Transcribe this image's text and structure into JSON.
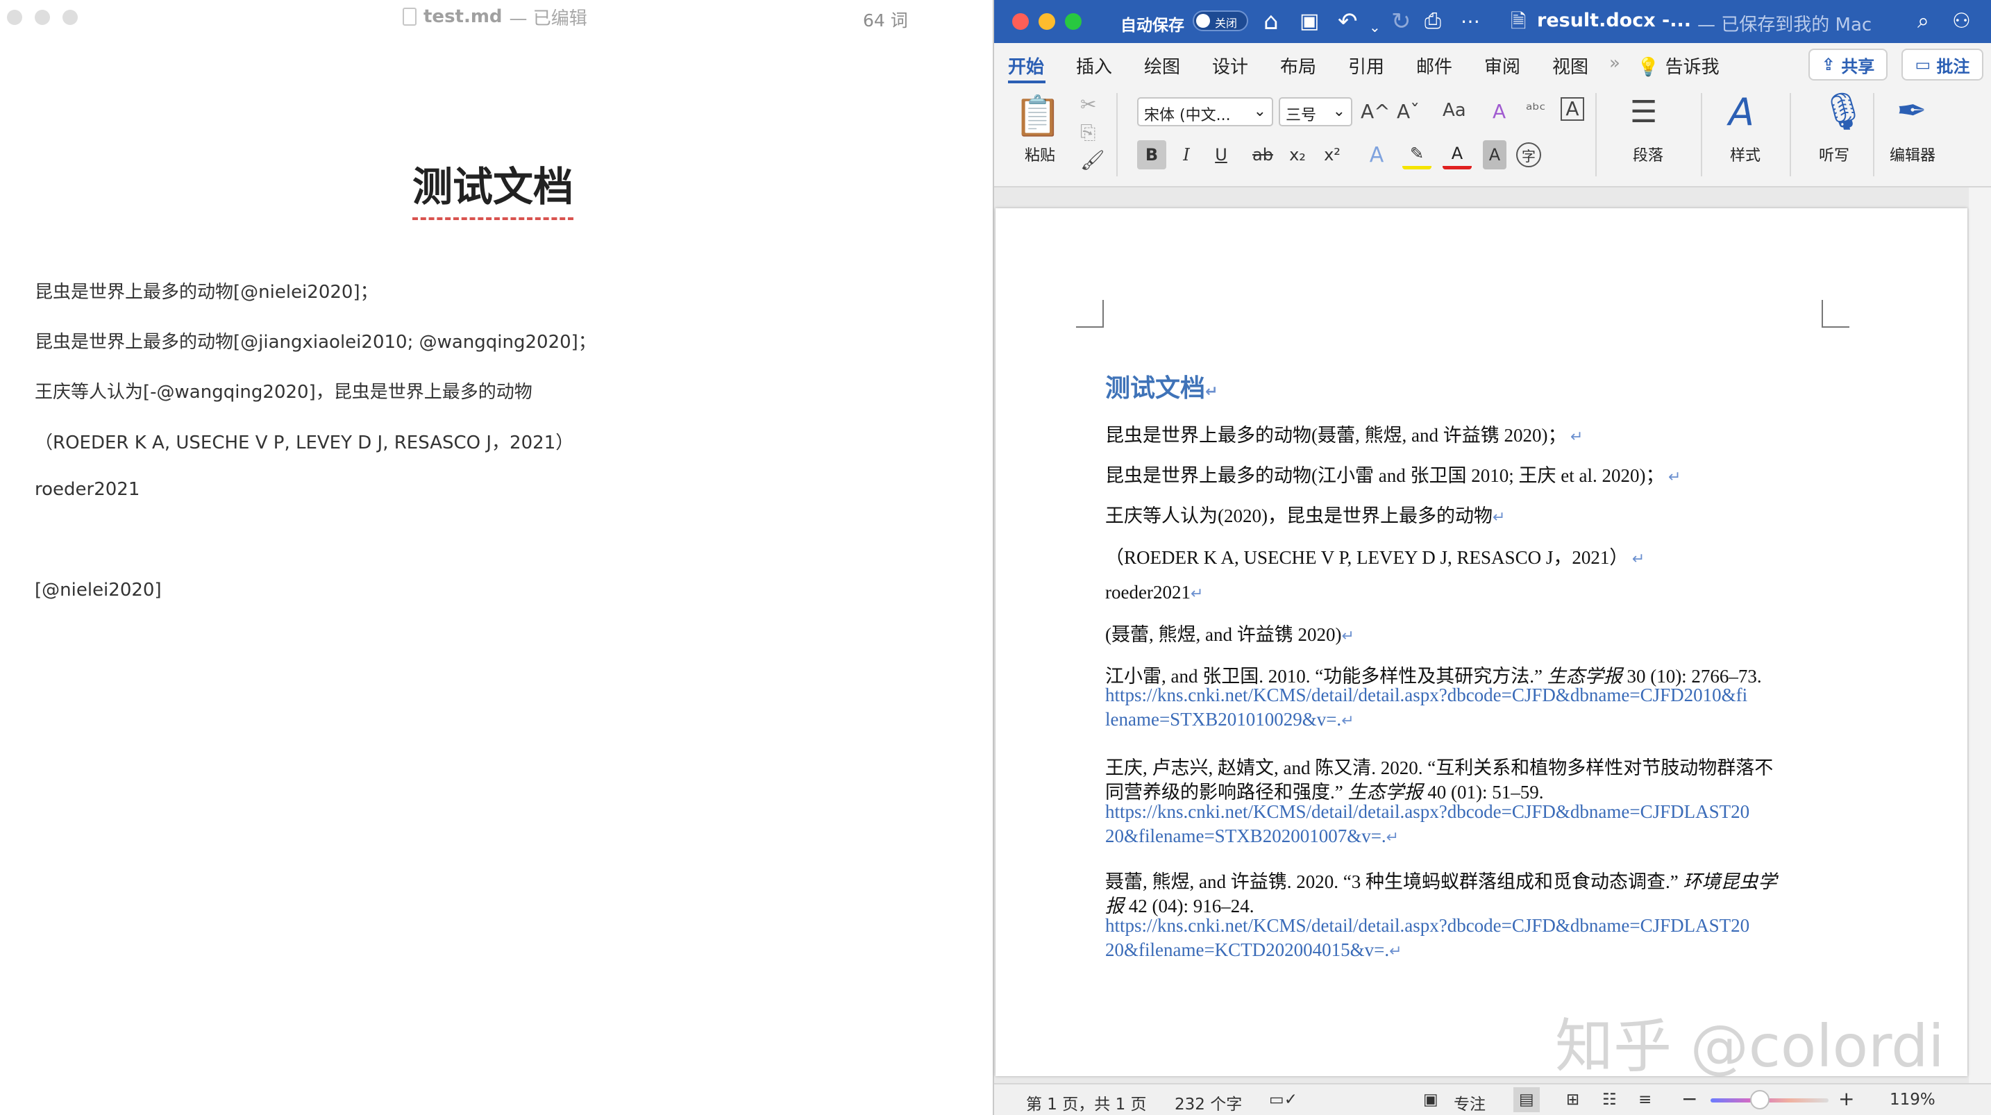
{
  "left": {
    "filename": "test.md",
    "status": "— 已编辑",
    "word_count": "64 词",
    "heading": "测试文档",
    "paragraphs": [
      "昆虫是世界上最多的动物[@nielei2020]；",
      "昆虫是世界上最多的动物[@jiangxiaolei2010; @wangqing2020]；",
      "王庆等人认为[-@wangqing2020]，昆虫是世界上最多的动物",
      "（ROEDER K A, USECHE V P, LEVEY D J, RESASCO J，2021）",
      "roeder2021",
      "[@nielei2020]"
    ]
  },
  "word": {
    "autosave_label": "自动保存",
    "autosave_state": "关闭",
    "doc_name": "result.docx  -...",
    "saved_status": "— 已保存到我的 Mac",
    "tabs": [
      "开始",
      "插入",
      "绘图",
      "设计",
      "布局",
      "引用",
      "邮件",
      "审阅",
      "视图"
    ],
    "tell_me": "告诉我",
    "share_label": "共享",
    "comment_label": "批注",
    "ribbon": {
      "paste_label": "粘贴",
      "font_name": "宋体 (中文...",
      "font_size": "三号",
      "paragraph_label": "段落",
      "styles_label": "样式",
      "dictate_label": "听写",
      "editor_label": "编辑器",
      "bold": "B",
      "italic": "I",
      "underline": "U",
      "strike": "ab",
      "subscript": "x₂",
      "superscript": "x²",
      "grow_font": "A^",
      "shrink_font": "Aˇ",
      "case": "Aa"
    },
    "document": {
      "title": "测试文档",
      "lines": [
        "昆虫是世界上最多的动物(聂蕾, 熊煜, and 许益镌 2020)；",
        "昆虫是世界上最多的动物(江小雷 and 张卫国 2010; 王庆 et al. 2020)；",
        "王庆等人认为(2020)，昆虫是世界上最多的动物",
        "（ROEDER K A, USECHE V P, LEVEY D J, RESASCO J，2021）",
        "roeder2021",
        "(聂蕾, 熊煜, and 许益镌 2020)"
      ],
      "refs": [
        {
          "text1": "江小雷, and 张卫国. 2010. “功能多样性及其研究方法.” ",
          "journal": "生态学报",
          "text2": " 30 (10): 2766–73.",
          "url1": "https://kns.cnki.net/KCMS/detail/detail.aspx?dbcode=CJFD&dbname=CJFD2010&fi",
          "url2": "lename=STXB201010029&v=."
        },
        {
          "text1": "王庆, 卢志兴, 赵婧文, and 陈又清. 2020. “互利关系和植物多样性对节肢动物群落不",
          "text1b": "同营养级的影响路径和强度.” ",
          "journal": "生态学报",
          "text2": " 40 (01): 51–59.",
          "url1": "https://kns.cnki.net/KCMS/detail/detail.aspx?dbcode=CJFD&dbname=CJFDLAST20",
          "url2": "20&filename=STXB202001007&v=."
        },
        {
          "text1": "聂蕾, 熊煜, and 许益镌. 2020. “3 种生境蚂蚁群落组成和觅食动态调查.” ",
          "journal_a": "环境昆虫学",
          "journal_b": "报",
          "text2": " 42 (04): 916–24.",
          "url1": "https://kns.cnki.net/KCMS/detail/detail.aspx?dbcode=CJFD&dbname=CJFDLAST20",
          "url2": "20&filename=KCTD202004015&v=."
        }
      ]
    },
    "status": {
      "page": "第 1 页，共 1 页",
      "chars": "232 个字",
      "focus": "专注",
      "zoom": "119%"
    },
    "zoom_level_fraction": 0.42
  },
  "watermark": "知乎 @colordi"
}
